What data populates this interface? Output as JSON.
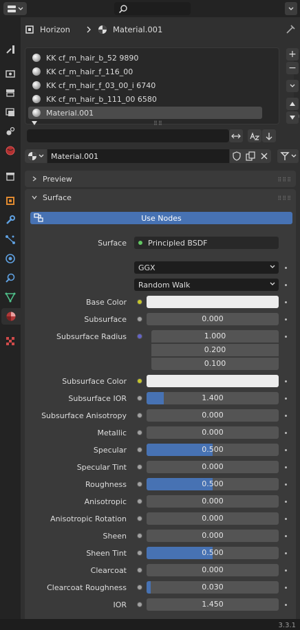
{
  "breadcrumb": {
    "object": "Horizon",
    "material": "Material.001"
  },
  "slots": [
    "KK cf_m_hair_b_52 9890",
    "KK cf_m_hair_f_116_00",
    "KK cf_m_hair_f_03_00_i 6740",
    "KK cf_m_hair_b_111_00 6580",
    "Material.001"
  ],
  "selected_slot": "Material.001",
  "material_name": "Material.001",
  "panels": {
    "preview": "Preview",
    "surface": "Surface"
  },
  "use_nodes_label": "Use Nodes",
  "surface": {
    "label": "Surface",
    "shader": "Principled BSDF"
  },
  "distribution": "GGX",
  "subsurface_method": "Random Walk",
  "props": [
    {
      "label": "Base Color",
      "socket": "yellow",
      "type": "color"
    },
    {
      "label": "Subsurface",
      "socket": "grey",
      "value": "0.000",
      "fraction": 0
    },
    {
      "label": "Subsurface Radius",
      "socket": "blue",
      "type": "vector",
      "values": [
        "1.000",
        "0.200",
        "0.100"
      ]
    },
    {
      "label": "Subsurface Color",
      "socket": "yellow",
      "type": "color"
    },
    {
      "label": "Subsurface IOR",
      "socket": "grey",
      "value": "1.400",
      "fraction": 0.13
    },
    {
      "label": "Subsurface Anisotropy",
      "socket": "grey",
      "value": "0.000",
      "fraction": 0
    },
    {
      "label": "Metallic",
      "socket": "grey",
      "value": "0.000",
      "fraction": 0
    },
    {
      "label": "Specular",
      "socket": "grey",
      "value": "0.500",
      "fraction": 0.5
    },
    {
      "label": "Specular Tint",
      "socket": "grey",
      "value": "0.000",
      "fraction": 0
    },
    {
      "label": "Roughness",
      "socket": "grey",
      "value": "0.500",
      "fraction": 0.5
    },
    {
      "label": "Anisotropic",
      "socket": "grey",
      "value": "0.000",
      "fraction": 0
    },
    {
      "label": "Anisotropic Rotation",
      "socket": "grey",
      "value": "0.000",
      "fraction": 0
    },
    {
      "label": "Sheen",
      "socket": "grey",
      "value": "0.000",
      "fraction": 0
    },
    {
      "label": "Sheen Tint",
      "socket": "grey",
      "value": "0.500",
      "fraction": 0.5
    },
    {
      "label": "Clearcoat",
      "socket": "grey",
      "value": "0.000",
      "fraction": 0
    },
    {
      "label": "Clearcoat Roughness",
      "socket": "grey",
      "value": "0.030",
      "fraction": 0.03
    },
    {
      "label": "IOR",
      "socket": "grey",
      "value": "1.450",
      "fraction": 0
    }
  ],
  "version": "3.3.1",
  "colors": {
    "accent": "#4772b3",
    "panel": "#303030",
    "sidebar": "#232323"
  }
}
